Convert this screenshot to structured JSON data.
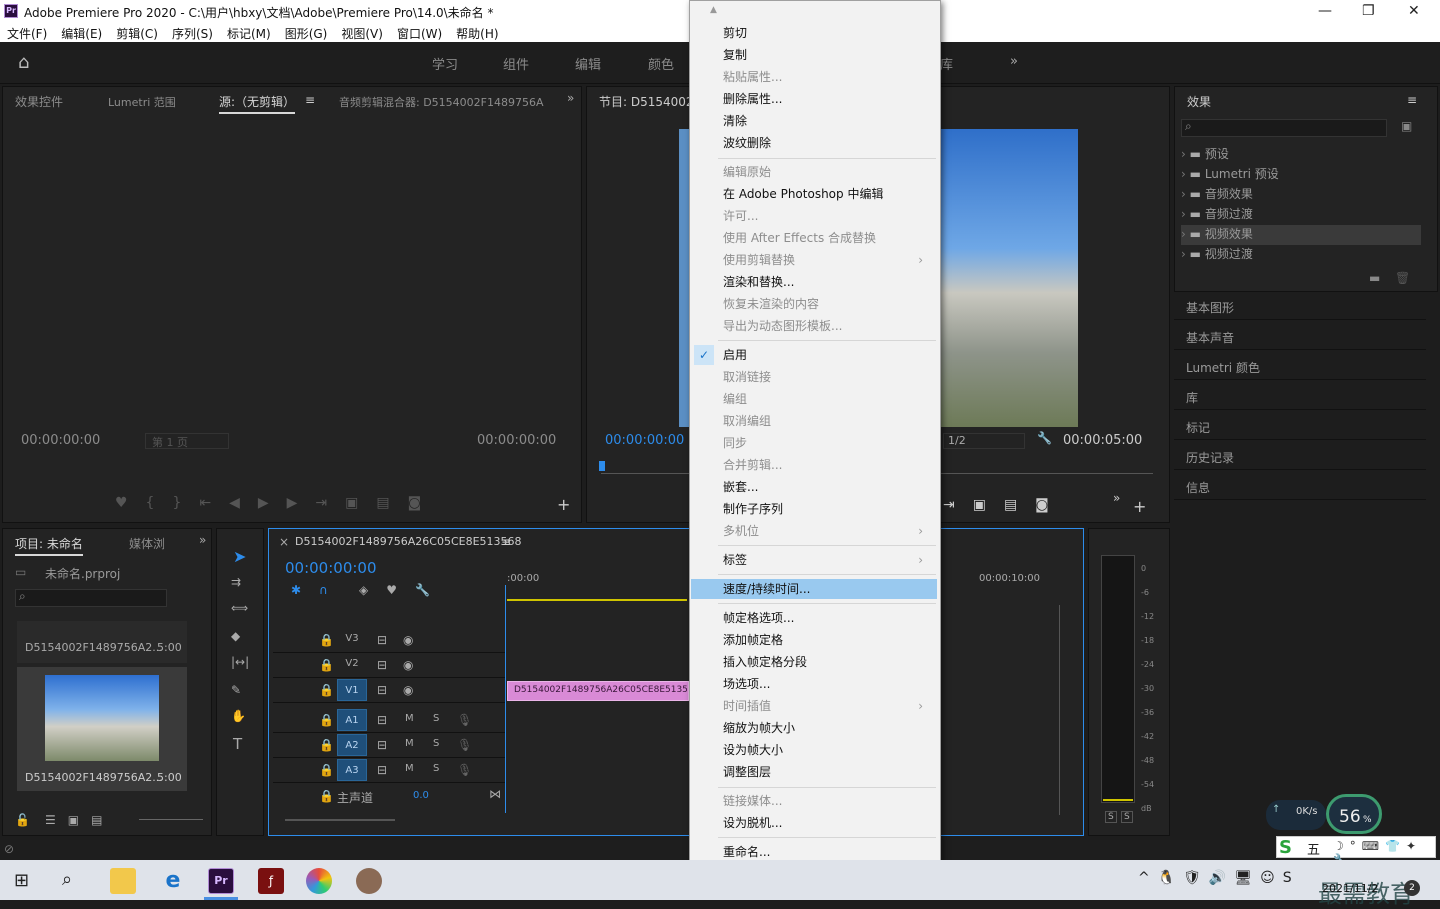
{
  "window": {
    "title": "Adobe Premiere Pro 2020 - C:\\用户\\hbxy\\文档\\Adobe\\Premiere Pro\\14.0\\未命名 *",
    "app_icon": "Pr"
  },
  "menubar": [
    "文件(F)",
    "编辑(E)",
    "剪辑(C)",
    "序列(S)",
    "标记(M)",
    "图形(G)",
    "视图(V)",
    "窗口(W)",
    "帮助(H)"
  ],
  "workspaces": [
    "学习",
    "组件",
    "编辑",
    "颜色",
    "库"
  ],
  "source_panel": {
    "tabs": [
      "效果控件",
      "Lumetri 范围",
      "源:（无剪辑）",
      "音频剪辑混合器: D5154002F1489756A"
    ],
    "tc_left": "00:00:00:00",
    "tc_right": "00:00:00:00",
    "page": "第 1 页"
  },
  "program_panel": {
    "title": "节目: D5154002F",
    "tc_left": "00:00:00:00",
    "tc_right": "00:00:05:00",
    "zoom": "1/2"
  },
  "project_panel": {
    "tabs": [
      "项目: 未命名",
      "媒体浏"
    ],
    "project_file": "未命名.prproj",
    "items": [
      {
        "name": "D5154002F1489756A2...",
        "duration": "5:00"
      },
      {
        "name": "D5154002F1489756A2...",
        "duration": "5:00"
      }
    ]
  },
  "timeline": {
    "sequence": "D5154002F1489756A26C05CE8E513568",
    "timecode": "00:00:00:00",
    "ruler_start": ":00:00",
    "ruler_mark": "00:00:10:00",
    "clip": "D5154002F1489756A26C05CE8E5135",
    "tracks_video": [
      "V3",
      "V2",
      "V1"
    ],
    "tracks_audio": [
      "A1",
      "A2",
      "A3"
    ],
    "master": "主声道",
    "master_val": "0.0",
    "m": "M",
    "s": "S"
  },
  "meter": {
    "scale": [
      "0",
      "-6",
      "-12",
      "-18",
      "-24",
      "-30",
      "-36",
      "-42",
      "-48",
      "-54",
      "dB"
    ],
    "solo": [
      "S",
      "S"
    ]
  },
  "effects": {
    "title": "效果",
    "folders": [
      "预设",
      "Lumetri 预设",
      "音频效果",
      "音频过渡",
      "视频效果",
      "视频过渡"
    ]
  },
  "right_panels": [
    "基本图形",
    "基本声音",
    "Lumetri 颜色",
    "库",
    "标记",
    "历史记录",
    "信息"
  ],
  "context_menu": [
    {
      "label": "剪切",
      "state": "enabled"
    },
    {
      "label": "复制",
      "state": "enabled"
    },
    {
      "label": "粘贴属性...",
      "state": "disabled"
    },
    {
      "label": "删除属性...",
      "state": "enabled"
    },
    {
      "label": "清除",
      "state": "enabled"
    },
    {
      "label": "波纹删除",
      "state": "enabled"
    },
    {
      "label": "编辑原始",
      "state": "disabled"
    },
    {
      "label": "在 Adobe Photoshop 中编辑",
      "state": "enabled"
    },
    {
      "label": "许可...",
      "state": "disabled"
    },
    {
      "label": "使用 After Effects 合成替换",
      "state": "disabled"
    },
    {
      "label": "使用剪辑替换",
      "state": "disabled",
      "submenu": true
    },
    {
      "label": "渲染和替换...",
      "state": "enabled"
    },
    {
      "label": "恢复未渲染的内容",
      "state": "disabled"
    },
    {
      "label": "导出为动态图形模板...",
      "state": "disabled"
    },
    {
      "label": "启用",
      "state": "enabled",
      "checked": true
    },
    {
      "label": "取消链接",
      "state": "disabled"
    },
    {
      "label": "编组",
      "state": "disabled"
    },
    {
      "label": "取消编组",
      "state": "disabled"
    },
    {
      "label": "同步",
      "state": "disabled"
    },
    {
      "label": "合并剪辑...",
      "state": "disabled"
    },
    {
      "label": "嵌套...",
      "state": "enabled"
    },
    {
      "label": "制作子序列",
      "state": "enabled"
    },
    {
      "label": "多机位",
      "state": "disabled",
      "submenu": true
    },
    {
      "label": "标签",
      "state": "enabled",
      "submenu": true
    },
    {
      "label": "速度/持续时间...",
      "state": "highlighted"
    },
    {
      "label": "帧定格选项...",
      "state": "enabled"
    },
    {
      "label": "添加帧定格",
      "state": "enabled"
    },
    {
      "label": "插入帧定格分段",
      "state": "enabled"
    },
    {
      "label": "场选项...",
      "state": "enabled"
    },
    {
      "label": "时间插值",
      "state": "disabled",
      "submenu": true
    },
    {
      "label": "缩放为帧大小",
      "state": "enabled"
    },
    {
      "label": "设为帧大小",
      "state": "enabled"
    },
    {
      "label": "调整图层",
      "state": "enabled"
    },
    {
      "label": "链接媒体...",
      "state": "disabled"
    },
    {
      "label": "设为脱机...",
      "state": "enabled"
    },
    {
      "label": "重命名...",
      "state": "enabled"
    }
  ],
  "tray": {
    "speed": "0K/s",
    "cpu": "56",
    "cpu_unit": "%",
    "ime": "五",
    "date": "2021/11/2",
    "badge": "2",
    "watermark": "最需教育"
  }
}
